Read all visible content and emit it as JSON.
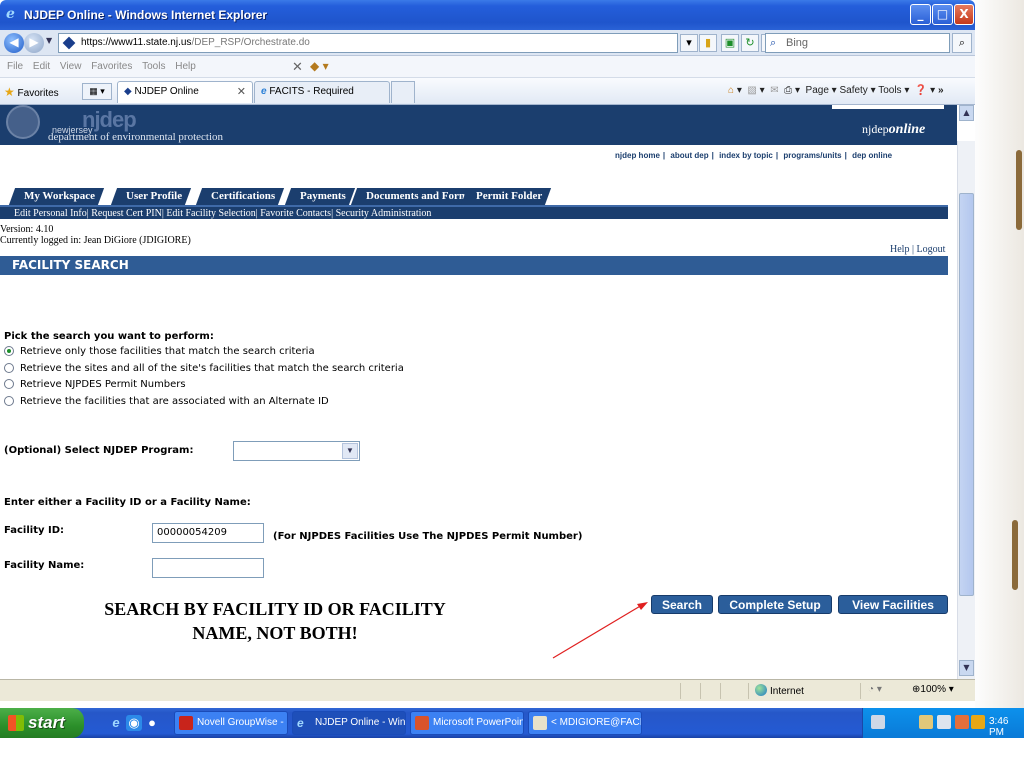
{
  "window": {
    "title": "NJDEP Online - Windows Internet Explorer",
    "minimize": "_",
    "maximize": "□",
    "close": "X"
  },
  "address": {
    "url_prefix": "https://www11.",
    "url_domain": "state.nj.us",
    "url_path": "/DEP_RSP/Orchestrate.do",
    "search_placeholder": "Bing",
    "lock_icon": "lock-icon",
    "refresh_icon": "refresh-icon",
    "stop_icon": "stop-icon"
  },
  "menu": {
    "items": [
      "File",
      "Edit",
      "View",
      "Favorites",
      "Tools",
      "Help"
    ]
  },
  "favorites": {
    "label": "Favorites",
    "tabs": [
      {
        "label": "NJDEP Online",
        "active": true
      },
      {
        "label": "FACITS - Required Browser ...",
        "active": false
      }
    ],
    "commands": "Page ▾   Safety ▾   Tools ▾"
  },
  "header": {
    "logo_state": "newjersey",
    "logo_name": "njdep",
    "logo_sub": "department of environmental protection",
    "brand_prefix": "njdep",
    "brand_suffix": "online",
    "top_links": [
      "njdep home",
      "about dep",
      "index by topic",
      "programs/units",
      "dep online"
    ]
  },
  "nav": {
    "tabs": [
      "My Workspace",
      "User Profile",
      "Certifications",
      "Payments",
      "Documents and Forms",
      "Permit Folder"
    ],
    "subnav": "Edit Personal Info| Request Cert PIN| Edit Facility Selection| Favorite Contacts| Security Administration"
  },
  "session": {
    "version": "Version: 4.10",
    "logged_in": "Currently logged in: Jean DiGiore (JDIGIORE)",
    "help": "Help",
    "logout": "Logout",
    "help_sep": " | "
  },
  "section": {
    "title": "FACILITY SEARCH"
  },
  "form": {
    "pick_label": "Pick the search you want to perform:",
    "options": [
      {
        "label": "Retrieve only those facilities that match the search criteria",
        "checked": true
      },
      {
        "label": "Retrieve the sites and all of the site's facilities that match the search criteria",
        "checked": false
      },
      {
        "label": "Retrieve NJPDES Permit Numbers",
        "checked": false
      },
      {
        "label": "Retrieve the facilities that are associated with an Alternate ID",
        "checked": false
      }
    ],
    "program_label": "(Optional) Select NJDEP Program:",
    "program_value": "",
    "enter_label": "Enter either a Facility ID or a Facility Name:",
    "facility_id_label": "Facility ID:",
    "facility_id_value": "00000054209",
    "facility_id_note": "(For NJPDES Facilities Use The NJPDES Permit Number)",
    "facility_name_label": "Facility Name:",
    "facility_name_value": "",
    "note_line1": "SEARCH BY FACILITY ID OR FACILITY",
    "note_line2": "NAME, NOT BOTH!",
    "buttons": {
      "search": "Search",
      "complete_setup": "Complete Setup",
      "view_facilities": "View Facilities"
    }
  },
  "statusbar": {
    "zone": "Internet",
    "zoom": "100%"
  },
  "taskbar": {
    "start": "start",
    "items": [
      "Novell GroupWise - M...",
      "NJDEP Online - Windo...",
      "Microsoft PowerPoint ...",
      "< MDIGIORE@FACIT..."
    ],
    "time": "3:46 PM"
  },
  "colors": {
    "njdep_navy": "#1b3e6e",
    "section_blue": "#2f5c95",
    "button_blue": "#2b5e9b",
    "annotation_arrow": "#e02020"
  }
}
